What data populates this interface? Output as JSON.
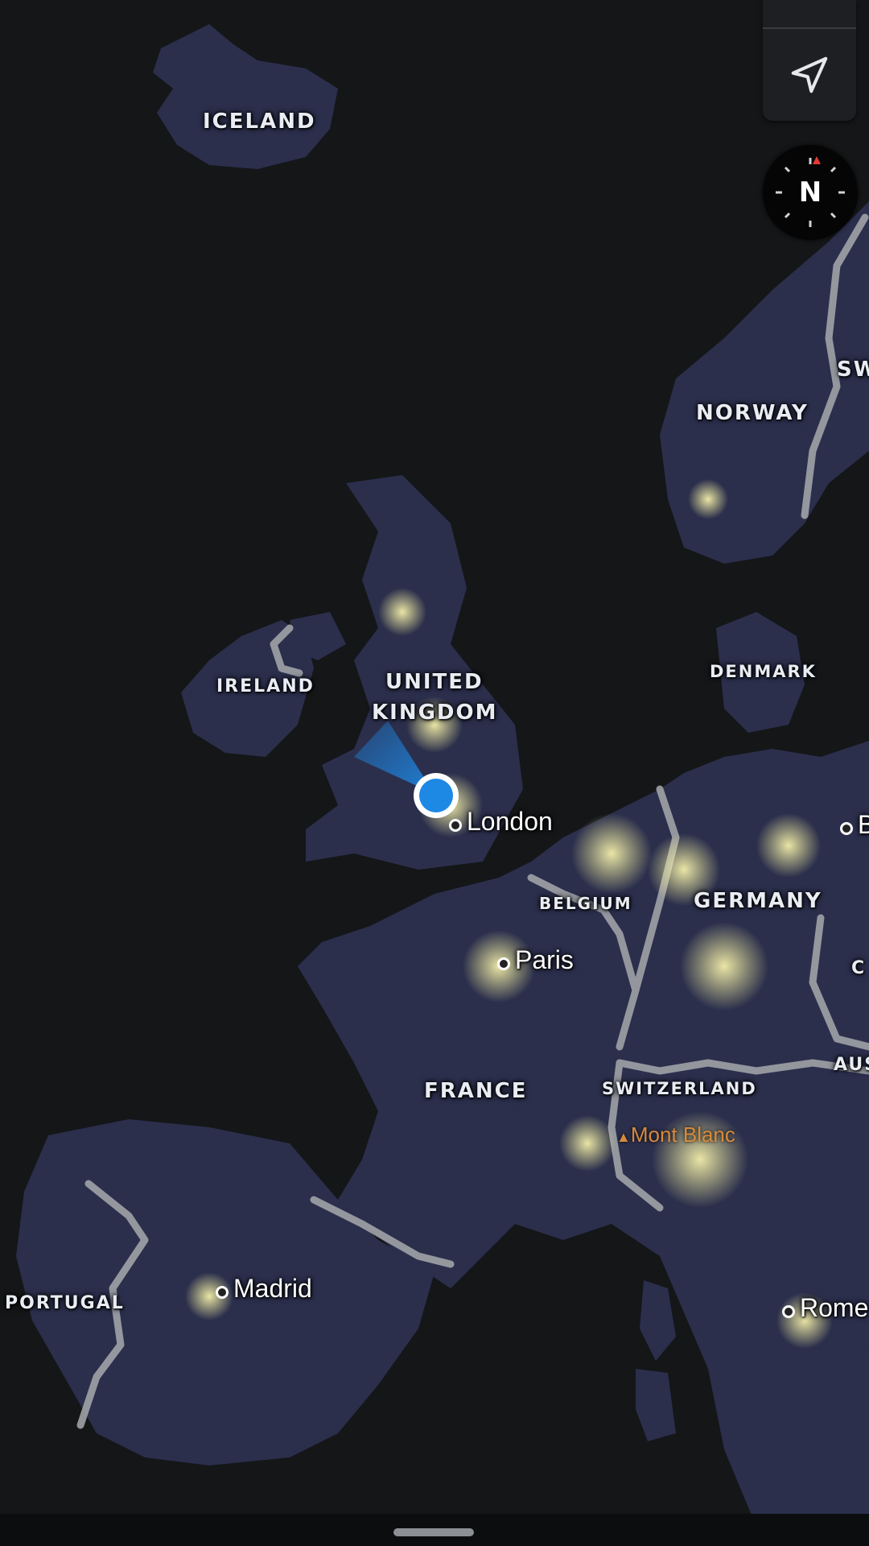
{
  "map": {
    "style": "night-lights-satellite",
    "colors": {
      "ocean": "#141618",
      "land": "#2b2f4c",
      "city_lights": "#f4f19a",
      "border": "#a7a9ad",
      "location_dot": "#1e88e5",
      "poi": "#d78a3d"
    },
    "countries": [
      {
        "id": "iceland",
        "label": "ICELAND"
      },
      {
        "id": "norway",
        "label": "NORWAY"
      },
      {
        "id": "sweden",
        "label": "SW"
      },
      {
        "id": "ireland",
        "label": "IRELAND"
      },
      {
        "id": "uk_line1",
        "label": "UNITED"
      },
      {
        "id": "uk_line2",
        "label": "KINGDOM"
      },
      {
        "id": "denmark",
        "label": "DENMARK"
      },
      {
        "id": "belgium",
        "label": "BELGIUM"
      },
      {
        "id": "germany",
        "label": "GERMANY"
      },
      {
        "id": "france",
        "label": "FRANCE"
      },
      {
        "id": "switzerland",
        "label": "SWITZERLAND"
      },
      {
        "id": "austria",
        "label": "AUS"
      },
      {
        "id": "czechia",
        "label": "C"
      },
      {
        "id": "portugal",
        "label": "PORTUGAL"
      }
    ],
    "cities": [
      {
        "id": "london",
        "label": "London"
      },
      {
        "id": "paris",
        "label": "Paris"
      },
      {
        "id": "madrid",
        "label": "Madrid"
      },
      {
        "id": "rome",
        "label": "Rome"
      },
      {
        "id": "berlin",
        "label": "B"
      }
    ],
    "poi": [
      {
        "id": "mont-blanc",
        "label": "Mont Blanc",
        "icon": "mountain-triangle-icon"
      }
    ]
  },
  "controls": {
    "locate_icon": "navigation-arrow-icon",
    "compass_label": "N",
    "compass_icon": "compass-icon"
  }
}
